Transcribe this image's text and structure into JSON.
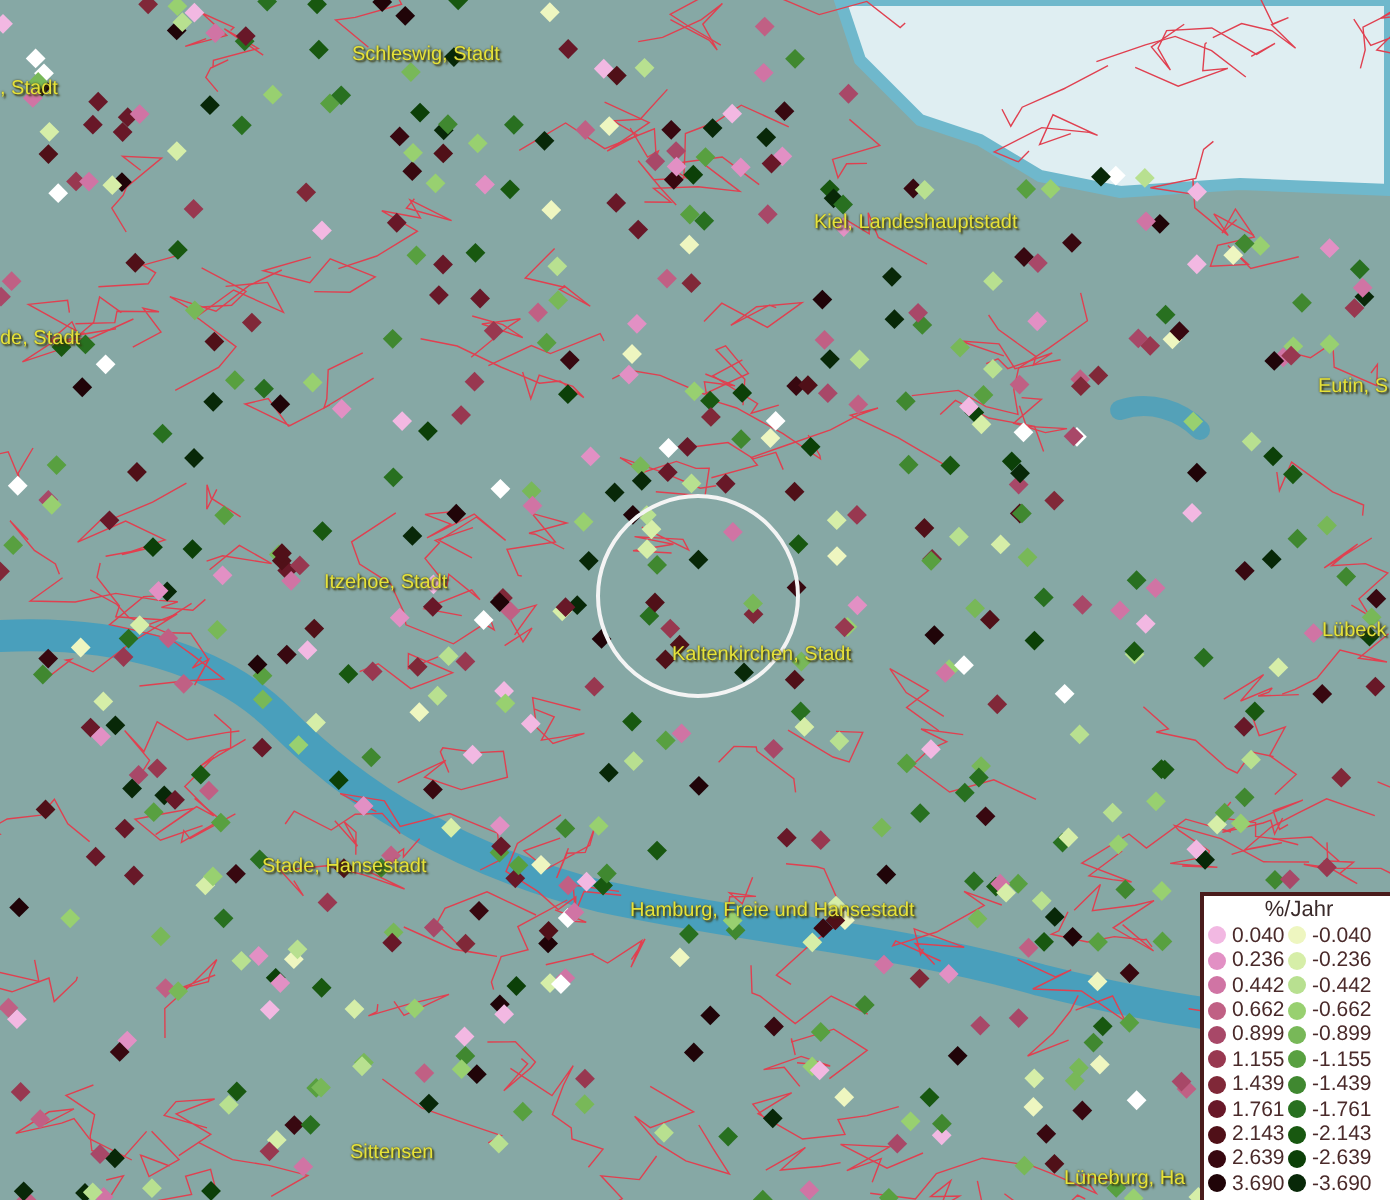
{
  "map": {
    "places": [
      {
        "name": "Schleswig, Stadt"
      },
      {
        "name": ", Stadt"
      },
      {
        "name": "Kiel, Landeshauptstadt"
      },
      {
        "name": "de, Stadt"
      },
      {
        "name": "Eutin, S"
      },
      {
        "name": "Itzehoe, Stadt"
      },
      {
        "name": "Lübeck"
      },
      {
        "name": "Kaltenkirchen, Stadt"
      },
      {
        "name": "Stade, Hansestadt"
      },
      {
        "name": "Hamburg, Freie und Hansestadt"
      },
      {
        "name": "Sittensen"
      },
      {
        "name": "Lüneburg, Ha"
      }
    ]
  },
  "legend": {
    "title": "%/Jahr",
    "items": [
      {
        "value": "0.040",
        "color": "#f2b8e2"
      },
      {
        "value": "-0.040",
        "color": "#eef6c0"
      },
      {
        "value": "0.236",
        "color": "#e290c4"
      },
      {
        "value": "-0.236",
        "color": "#d6eea8"
      },
      {
        "value": "0.442",
        "color": "#d074a4"
      },
      {
        "value": "-0.442",
        "color": "#b8e090"
      },
      {
        "value": "0.662",
        "color": "#c06084"
      },
      {
        "value": "-0.662",
        "color": "#98d070"
      },
      {
        "value": "0.899",
        "color": "#a84868"
      },
      {
        "value": "-0.899",
        "color": "#78b858"
      },
      {
        "value": "1.155",
        "color": "#983850"
      },
      {
        "value": "-1.155",
        "color": "#58a040"
      },
      {
        "value": "1.439",
        "color": "#802838"
      },
      {
        "value": "-1.439",
        "color": "#408830"
      },
      {
        "value": "1.761",
        "color": "#681828"
      },
      {
        "value": "-1.761",
        "color": "#287020"
      },
      {
        "value": "2.143",
        "color": "#501018"
      },
      {
        "value": "-2.143",
        "color": "#185810"
      },
      {
        "value": "2.639",
        "color": "#380810"
      },
      {
        "value": "-2.639",
        "color": "#0c4008"
      },
      {
        "value": "3.690",
        "color": "#200408"
      },
      {
        "value": "-3.690",
        "color": "#082808"
      }
    ]
  }
}
